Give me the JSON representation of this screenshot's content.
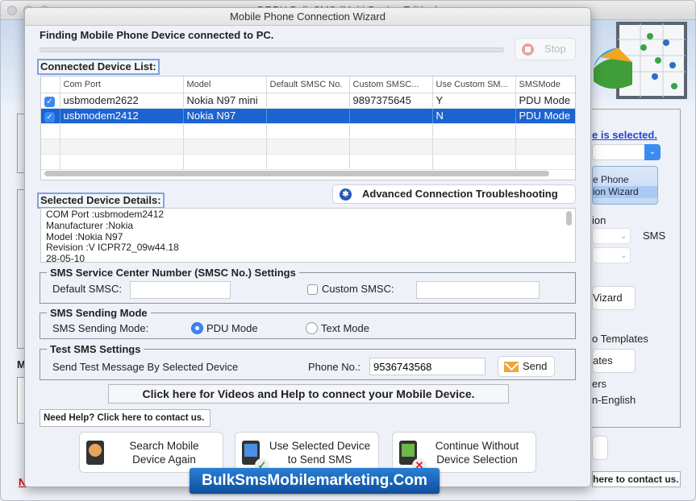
{
  "background_window": {
    "title": "DRPU Bulk SMS (Multi-Device Edition)",
    "link_text": "e is selected.",
    "wizard_button_lines": [
      "e Phone",
      "ion  Wizard"
    ],
    "labels": {
      "option": "ion",
      "sms": "SMS",
      "wizard": "Vizard",
      "templates_label": "o Templates",
      "templates_button": "ates",
      "others": "ers",
      "non_english": "n-English",
      "left_m": "M",
      "left_n": "N",
      "contact": "here to contact us."
    }
  },
  "dialog": {
    "title": "Mobile Phone Connection Wizard",
    "status_text": "Finding Mobile Phone Device connected to PC.",
    "progress_percent": 0,
    "stop_label": "Stop",
    "connected_list_label": "Connected Device List:",
    "table": {
      "columns": [
        "",
        "Com Port",
        "Model",
        "Default SMSC No.",
        "Custom SMSC...",
        "Use Custom SM...",
        "SMSMode"
      ],
      "rows": [
        {
          "checked": true,
          "com_port": "usbmodem2622",
          "model": "Nokia N97 mini",
          "default_smsc": "",
          "custom_smsc": "9897375645",
          "use_custom": "Y",
          "sms_mode": "PDU Mode",
          "selected": false
        },
        {
          "checked": true,
          "com_port": "usbmodem2412",
          "model": "Nokia N97",
          "default_smsc": "",
          "custom_smsc": "",
          "use_custom": "N",
          "sms_mode": "PDU Mode",
          "selected": true
        }
      ]
    },
    "advanced_button": "Advanced Connection Troubleshooting",
    "selected_details_label": "Selected Device Details:",
    "details_lines": [
      "COM Port :usbmodem2412",
      "Manufacturer :Nokia",
      "Model :Nokia N97",
      "Revision :V ICPR72_09w44.18",
      "28-05-10"
    ],
    "smsc_group": {
      "legend": "SMS Service Center Number (SMSC No.) Settings",
      "default_label": "Default SMSC:",
      "default_value": "",
      "custom_label": "Custom SMSC:",
      "custom_checked": false,
      "custom_value": ""
    },
    "mode_group": {
      "legend": "SMS Sending Mode",
      "label": "SMS Sending Mode:",
      "options": [
        "PDU Mode",
        "Text Mode"
      ],
      "selected": "PDU Mode"
    },
    "test_group": {
      "legend": "Test SMS Settings",
      "label": "Send Test Message By Selected Device",
      "phone_label": "Phone No.:",
      "phone_value": "9536743568",
      "send_label": "Send"
    },
    "videos_button": "Click here for Videos and Help to connect your Mobile Device.",
    "help_button": "Need Help? Click here to contact us.",
    "actions": [
      {
        "line1": "Search Mobile",
        "line2": "Device Again",
        "icon": "search-phone-icon"
      },
      {
        "line1": "Use Selected Device",
        "line2": "to Send SMS",
        "icon": "phone-check-icon"
      },
      {
        "line1": "Continue Without",
        "line2": "Device Selection",
        "icon": "phone-cancel-icon"
      }
    ]
  },
  "brand_banner": "BulkSmsMobilemarketing.Com",
  "colors": {
    "selection": "#1b63d1",
    "accent": "#3b87f0",
    "brand": "#0e4f9e"
  }
}
